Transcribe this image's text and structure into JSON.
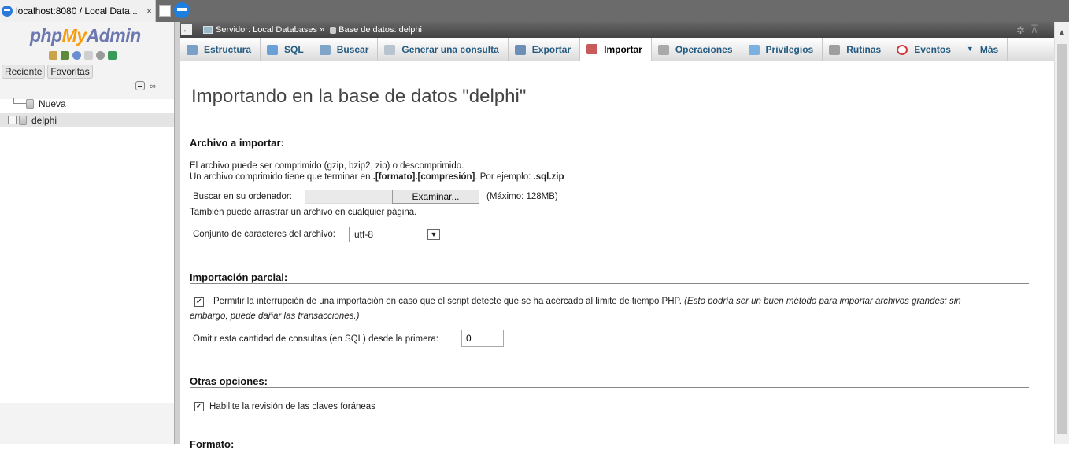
{
  "browser": {
    "tab_title": "localhost:8080 / Local Data...",
    "tab_close": "×"
  },
  "sidebar": {
    "logo": {
      "php": "php",
      "my": "My",
      "admin": "Admin"
    },
    "tabs": [
      "Reciente",
      "Favoritas"
    ],
    "tree": [
      {
        "label": "Nueva"
      },
      {
        "label": "delphi"
      }
    ]
  },
  "breadcrumb": {
    "back": "←",
    "server": "Servidor: Local Databases",
    "separator": "»",
    "database": "Base de datos: delphi"
  },
  "menu_tabs": [
    {
      "label": "Estructura",
      "icon": "structure-icon",
      "color": "#7aa0c8"
    },
    {
      "label": "SQL",
      "icon": "sql-icon",
      "color": "#6aa0d8"
    },
    {
      "label": "Buscar",
      "icon": "search-icon",
      "color": "#7fa6c9"
    },
    {
      "label": "Generar una consulta",
      "icon": "query-icon",
      "color": "#b7c4cf"
    },
    {
      "label": "Exportar",
      "icon": "export-icon",
      "color": "#6c8fb6"
    },
    {
      "label": "Importar",
      "icon": "import-icon",
      "color": "#c95a5a",
      "active": true
    },
    {
      "label": "Operaciones",
      "icon": "wrench-icon",
      "color": "#a9a9a9"
    },
    {
      "label": "Privilegios",
      "icon": "privileges-icon",
      "color": "#7bb0df"
    },
    {
      "label": "Rutinas",
      "icon": "routines-icon",
      "color": "#9e9e9e"
    },
    {
      "label": "Eventos",
      "icon": "clock-icon",
      "color": "#d23b3b"
    },
    {
      "label": "Más",
      "icon": "dropdown-icon",
      "color": "#333333"
    }
  ],
  "page": {
    "title": "Importando en la base de datos \"delphi\""
  },
  "import_file": {
    "heading": "Archivo a importar:",
    "desc1": "El archivo puede ser comprimido (gzip, bzip2, zip) o descomprimido.",
    "desc2_a": "Un archivo comprimido tiene que terminar en ",
    "desc2_b": ".[formato].[compresión]",
    "desc2_c": ". Por ejemplo: ",
    "desc2_d": ".sql.zip",
    "browse_label": "Buscar en su ordenador:",
    "browse_button": "Examinar...",
    "max_size": "(Máximo: 128MB)",
    "drag_hint": "También puede arrastrar un archivo en cualquier página.",
    "charset_label": "Conjunto de caracteres del archivo:",
    "charset_value": "utf-8"
  },
  "partial_import": {
    "heading": "Importación parcial:",
    "allow_interrupt_label": "Permitir la interrupción de una importación en caso que el script detecte que se ha acercado al límite de tiempo PHP.",
    "allow_interrupt_note_1": "(Esto podría ser un buen método para importar archivos grandes; sin",
    "allow_interrupt_note_2": "embargo, puede dañar las transacciones.)",
    "allow_interrupt_checked": true,
    "skip_label": "Omitir esta cantidad de consultas (en SQL) desde la primera:",
    "skip_value": "0"
  },
  "other_options": {
    "heading": "Otras opciones:",
    "fk_label": "Habilite la revisión de las claves foráneas",
    "fk_checked": true
  },
  "format": {
    "heading": "Formato:"
  }
}
